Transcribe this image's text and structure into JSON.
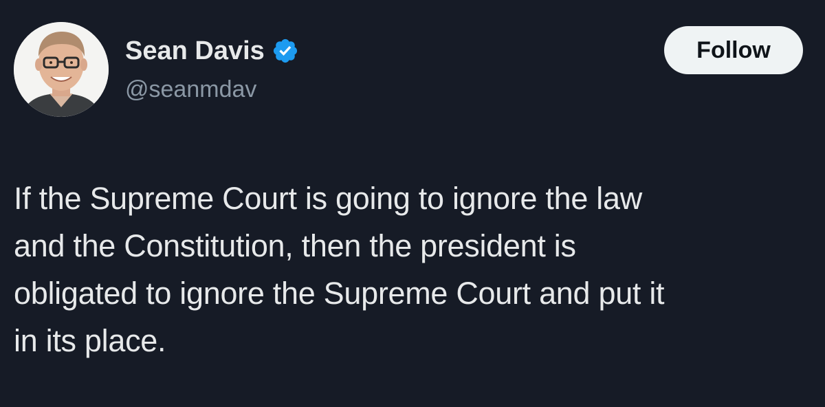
{
  "author": {
    "display_name": "Sean Davis",
    "handle": "@seanmdav",
    "verified": true,
    "avatar_icon": "profile-photo",
    "verified_icon": "verified-badge-icon"
  },
  "actions": {
    "follow_label": "Follow"
  },
  "tweet": {
    "text": "If the Supreme Court is going to ignore the law\nand the Constitution, then the president is\nobligated to ignore the Supreme Court and put it\nin its place."
  },
  "colors": {
    "background": "#161b26",
    "primary_text": "#e7e9ea",
    "secondary_text": "#8b98a5",
    "verified_blue": "#1d9bf0",
    "follow_button_bg": "#eff3f4"
  }
}
